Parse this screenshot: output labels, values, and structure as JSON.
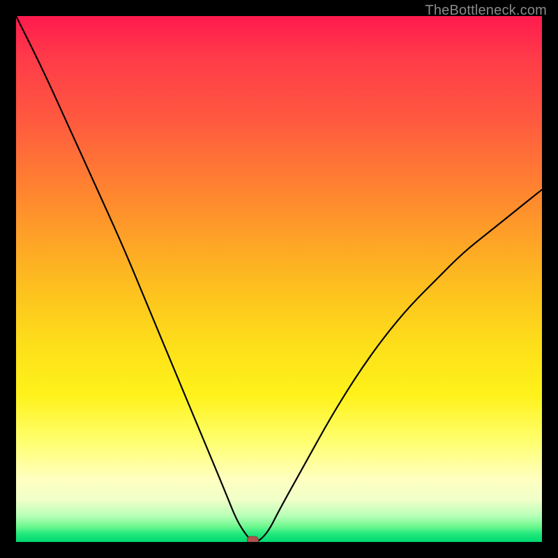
{
  "watermark": "TheBottleneck.com",
  "chart_data": {
    "type": "line",
    "title": "",
    "xlabel": "",
    "ylabel": "",
    "xlim": [
      0,
      100
    ],
    "ylim": [
      0,
      100
    ],
    "grid": false,
    "legend": false,
    "series": [
      {
        "name": "bottleneck-curve",
        "x": [
          0,
          5,
          10,
          15,
          20,
          25,
          30,
          35,
          40,
          42,
          44,
          45,
          46,
          48,
          50,
          55,
          60,
          65,
          70,
          75,
          80,
          85,
          90,
          95,
          100
        ],
        "y": [
          100,
          90,
          79,
          68,
          57,
          45,
          33,
          21,
          9,
          4,
          1,
          0,
          0,
          2,
          6,
          15,
          24,
          32,
          39,
          45,
          50,
          55,
          59,
          63,
          67
        ]
      }
    ],
    "marker": {
      "x": 45,
      "y": 0,
      "name": "optimal-point"
    },
    "background_gradient": {
      "stops": [
        {
          "pos": 0.0,
          "color": "#ff1a4d"
        },
        {
          "pos": 0.5,
          "color": "#fdbb20"
        },
        {
          "pos": 0.88,
          "color": "#ffffc0"
        },
        {
          "pos": 1.0,
          "color": "#00d86f"
        }
      ],
      "direction": "top-to-bottom"
    }
  }
}
